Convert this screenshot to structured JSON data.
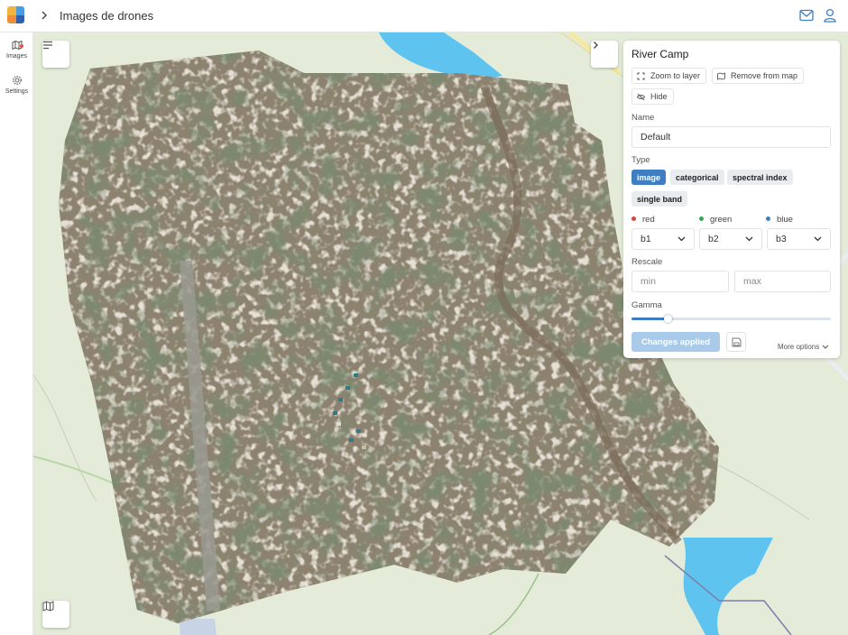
{
  "header": {
    "title": "Images de drones",
    "breadcrumb_icon": "chevron-right-icon",
    "icons": [
      "mail-icon",
      "user-icon"
    ]
  },
  "sidebar": {
    "items": [
      {
        "label": "Images",
        "icon": "images-icon",
        "badge": true
      },
      {
        "label": "Settings",
        "icon": "gear-icon",
        "badge": false
      }
    ]
  },
  "map": {
    "controls": [
      "layers-menu-icon",
      "basemap-icon",
      "collapse-panel-icon"
    ]
  },
  "panel": {
    "title": "River Camp",
    "zoom_label": "Zoom to layer",
    "remove_label": "Remove from map",
    "hide_label": "Hide",
    "name_label": "Name",
    "name_value": "Default",
    "type_label": "Type",
    "types": [
      "image",
      "categorical",
      "spectral index",
      "single band"
    ],
    "active_type": "image",
    "bands": [
      {
        "label": "red",
        "value": "b1",
        "color": "#d9453d"
      },
      {
        "label": "green",
        "value": "b2",
        "color": "#3aa45a"
      },
      {
        "label": "blue",
        "value": "b3",
        "color": "#3f7fc1"
      }
    ],
    "rescale_label": "Rescale",
    "min_placeholder": "min",
    "max_placeholder": "max",
    "gamma_label": "Gamma",
    "gamma_fraction": 0.18,
    "apply_label": "Changes applied",
    "more_options": "More options"
  },
  "colors": {
    "accent": "#3f7fc1",
    "apply_disabled": "#a9cbe9",
    "map_background": "#e4ecd9",
    "water": "#5ec3ee"
  }
}
